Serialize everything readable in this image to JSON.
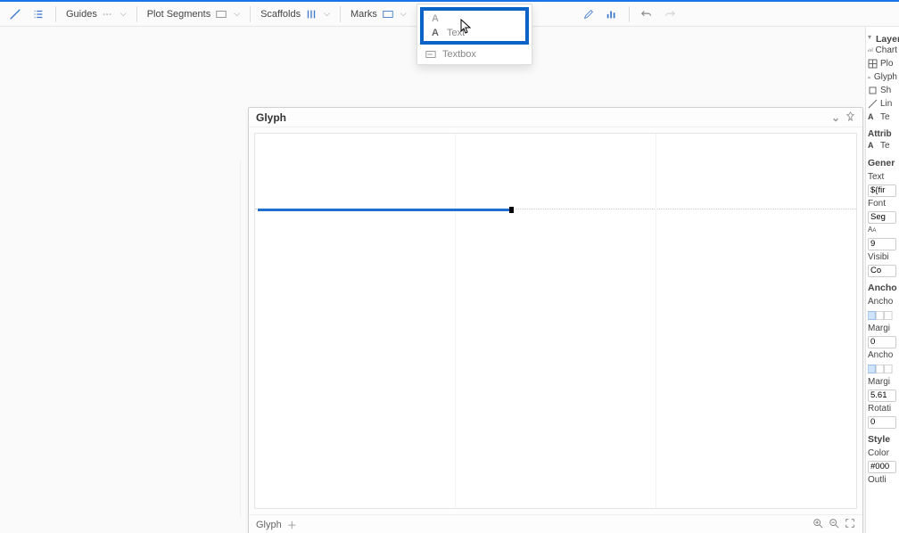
{
  "toolbar": {
    "guides_label": "Guides",
    "plot_segments_label": "Plot Segments",
    "scaffolds_label": "Scaffolds",
    "marks_label": "Marks"
  },
  "dropdown": {
    "text_label": "Text",
    "textbox_label": "Textbox"
  },
  "glyph_panel": {
    "title": "Glyph",
    "footer_label": "Glyph"
  },
  "right": {
    "layers_title": "Layers",
    "chart_label": "Chart",
    "plot_label": "Plo",
    "glyph_label": "Glyph",
    "shape_label": "Sh",
    "line_label": "Lin",
    "text_label": "Te",
    "attrib_title": "Attrib",
    "attr_text": "Te",
    "general_title": "Gener",
    "gen_text": "Text",
    "gen_text_val": "${fir",
    "font_label": "Font",
    "font_val": "Seg",
    "size_val": "9",
    "visibility_label": "Visibi",
    "visibility_val": "Co",
    "anchor_title": "Ancho",
    "anchor_label": "Ancho",
    "margin_label": "Margi",
    "margin_val": "0",
    "anchor2_label": "Ancho",
    "margin2_label": "Margi",
    "margin2_val": "5.61",
    "rotation_label": "Rotati",
    "rotation_val": "0",
    "style_title": "Style",
    "color_label": "Color",
    "color_val": "#000",
    "outline_label": "Outli"
  }
}
